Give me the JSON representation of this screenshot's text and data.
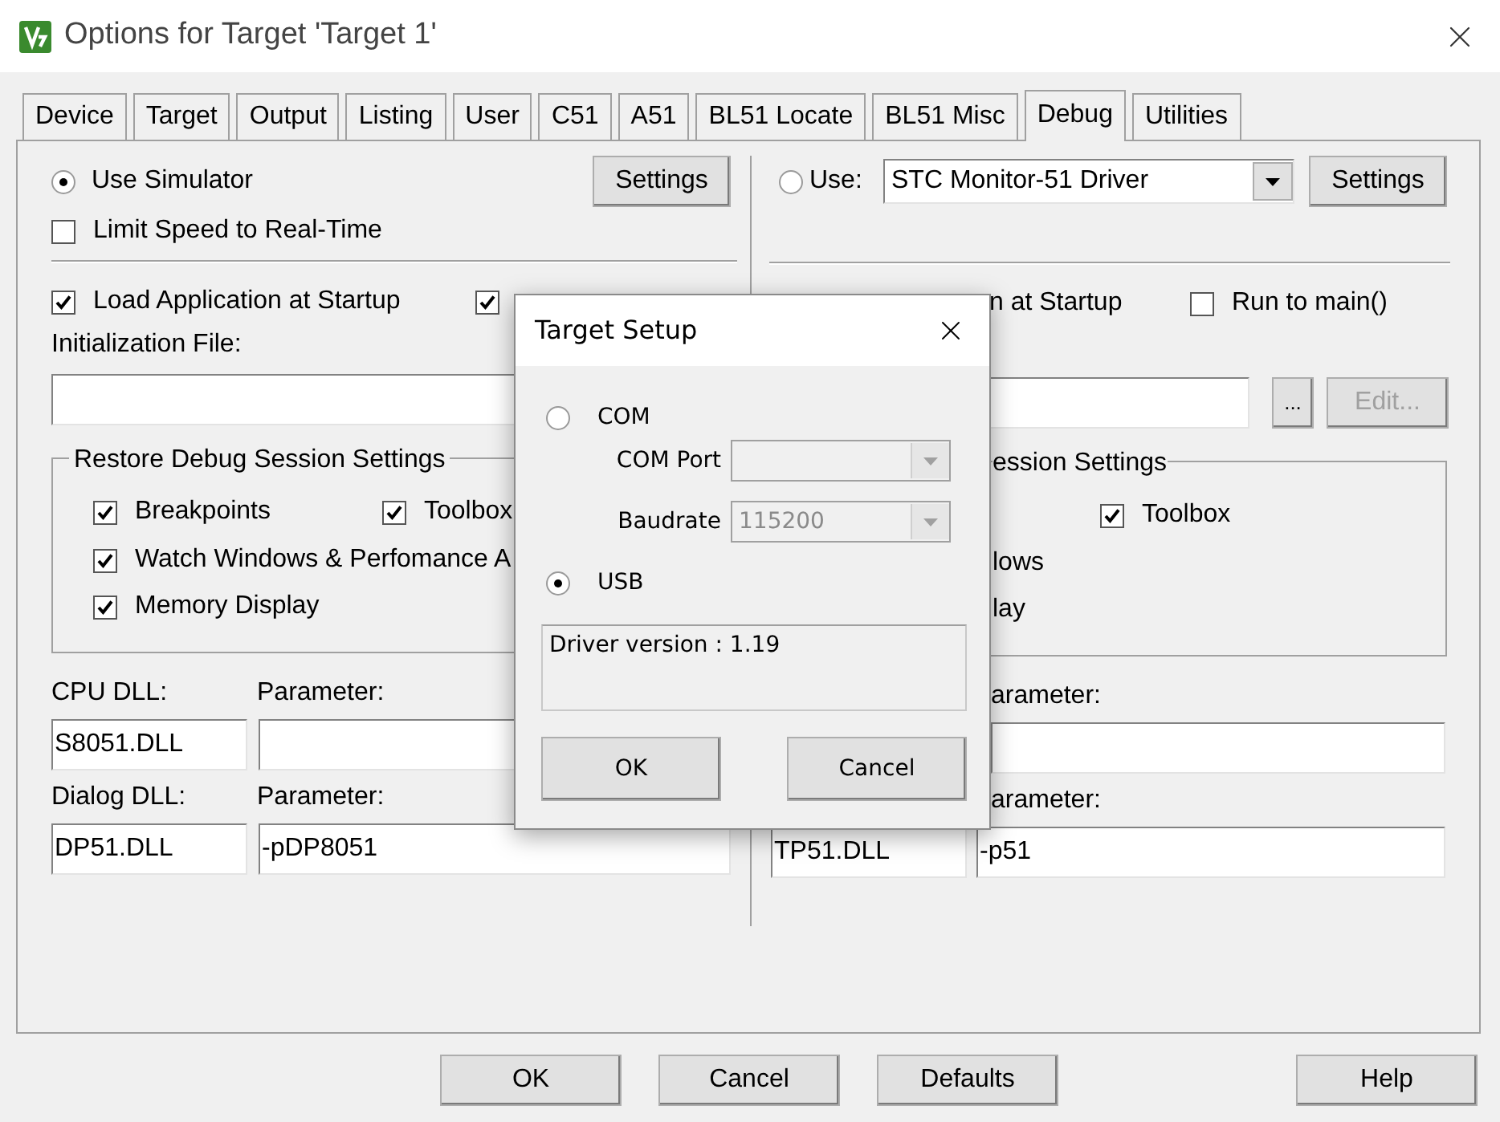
{
  "window": {
    "title": "Options for Target 'Target 1'"
  },
  "tabs": [
    {
      "label": "Device",
      "selected": false
    },
    {
      "label": "Target",
      "selected": false
    },
    {
      "label": "Output",
      "selected": false
    },
    {
      "label": "Listing",
      "selected": false
    },
    {
      "label": "User",
      "selected": false
    },
    {
      "label": "C51",
      "selected": false
    },
    {
      "label": "A51",
      "selected": false
    },
    {
      "label": "BL51 Locate",
      "selected": false
    },
    {
      "label": "BL51 Misc",
      "selected": false
    },
    {
      "label": "Debug",
      "selected": true
    },
    {
      "label": "Utilities",
      "selected": false
    }
  ],
  "simulator": {
    "use_simulator": {
      "label": "Use Simulator",
      "selected": true
    },
    "settings_button": "Settings",
    "limit_speed": {
      "label": "Limit Speed to Real-Time",
      "checked": false
    },
    "load_application": {
      "label": "Load Application at Startup",
      "checked": true
    },
    "run_to_main": {
      "checked": true
    },
    "initialization_file": {
      "label": "Initialization File:"
    },
    "restore_settings": {
      "title": "Restore Debug Session Settings",
      "options": [
        {
          "label": "Breakpoints",
          "checked": true
        },
        {
          "label": "Toolbox",
          "checked": true
        },
        {
          "label": "Watch Windows & Perfomance A",
          "checked": true
        },
        {
          "label": "Memory Display",
          "checked": true
        }
      ]
    },
    "cpu_dll": {
      "label": "CPU DLL:",
      "value": "S8051.DLL"
    },
    "cpu_parameter": {
      "label": "Parameter:"
    },
    "dialog_dll": {
      "label": "Dialog DLL:",
      "value": "DP51.DLL"
    },
    "dialog_parameter": {
      "label": "Parameter:",
      "value": "-pDP8051"
    }
  },
  "driver": {
    "use": {
      "label": "Use:",
      "selected": false
    },
    "driver_select": "STC Monitor-51 Driver",
    "settings_button": "Settings",
    "load_application": {
      "label": "n at Startup"
    },
    "run_to_main": {
      "label": "Run to main()",
      "checked": false
    },
    "browse_button": "...",
    "edit_button": {
      "label": "Edit...",
      "disabled": true
    },
    "restore_settings": {
      "title": "ession Settings",
      "options": [
        {
          "label": "Toolbox",
          "checked": true
        }
      ],
      "partial_labels": [
        "lows",
        "lay"
      ]
    },
    "cpu_parameter": {
      "label": "arameter:"
    },
    "dialog_dll": {
      "value": "TP51.DLL"
    },
    "dialog_parameter": {
      "label": "arameter:",
      "value": "-p51"
    }
  },
  "target_setup": {
    "title": "Target Setup",
    "com": {
      "label": "COM",
      "selected": false
    },
    "com_port": {
      "label": "COM Port",
      "disabled": true
    },
    "baudrate": {
      "label": "Baudrate",
      "value": "115200",
      "disabled": true
    },
    "usb": {
      "label": "USB",
      "selected": true
    },
    "driver_version": "Driver version : 1.19",
    "buttons": [
      "OK",
      "Cancel"
    ]
  },
  "buttons": [
    "OK",
    "Cancel",
    "Defaults",
    "Help"
  ]
}
